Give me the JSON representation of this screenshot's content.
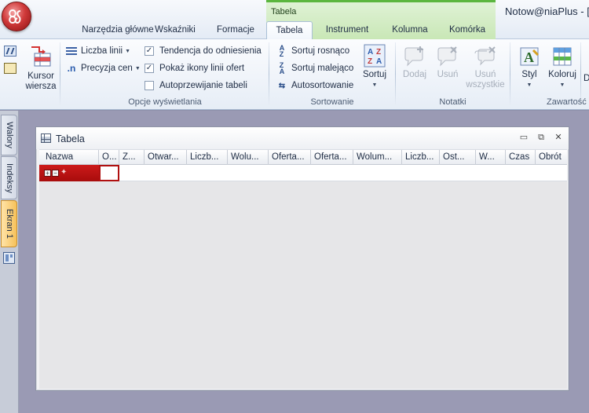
{
  "app": {
    "title": "Notow@niaPlus - ["
  },
  "context_group": {
    "label": "Tabela"
  },
  "tabs": [
    {
      "label": "Narzędzia główne"
    },
    {
      "label": "Wskaźniki"
    },
    {
      "label": "Formacje"
    },
    {
      "label": "Tabela"
    },
    {
      "label": "Instrument"
    },
    {
      "label": "Kolumna"
    },
    {
      "label": "Komórka"
    }
  ],
  "ribbon": {
    "cursor_row": {
      "line1": "Kursor",
      "line2": "wiersza"
    },
    "display": {
      "line_count": "Liczba linii",
      "price_precision": "Precyzja cen",
      "checks": [
        {
          "label": "Tendencja do odniesienia",
          "checked": "✓"
        },
        {
          "label": "Pokaż ikony linii ofert",
          "checked": "✓"
        },
        {
          "label": "Autoprzewijanie tabeli",
          "checked": ""
        }
      ],
      "group_label": "Opcje wyświetlania"
    },
    "sorting": {
      "asc": "Sortuj rosnąco",
      "desc": "Sortuj malejąco",
      "auto": "Autosortowanie",
      "sort": "Sortuj",
      "group_label": "Sortowanie"
    },
    "notes": {
      "add": "Dodaj",
      "remove": "Usuń",
      "remove_all_1": "Usuń",
      "remove_all_2": "wszystkie",
      "group_label": "Notatki"
    },
    "content": {
      "style": "Styl",
      "color": "Koloruj",
      "cut": "D",
      "group_label": "Zawartość"
    }
  },
  "side_tabs": [
    "Walory",
    "Indeksy",
    "Ekran 1"
  ],
  "window": {
    "title": "Tabela",
    "columns": [
      "Nazwa",
      "O...",
      "Z...",
      "Otwar...",
      "Liczb...",
      "Wolu...",
      "Oferta...",
      "Oferta...",
      "Wolum...",
      "Liczb...",
      "Ost...",
      "W...",
      "Czas",
      "Obrót"
    ]
  },
  "colors": {
    "accent": "#b01010",
    "context_green": "#5bb63f",
    "active_side_tab": "#f6c15a"
  }
}
